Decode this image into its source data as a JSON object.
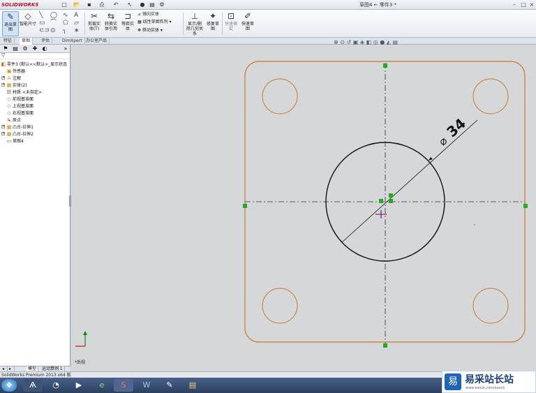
{
  "app": {
    "logo_text": "SOLIDWORKS",
    "document_title": "草图4 ← 零件3 *"
  },
  "ribbon": {
    "exit_sketch": "退出草图",
    "smart_dimension": "智能尺寸",
    "trim_entities": "剪裁实体(T)",
    "convert_entities": "转换实体引用",
    "offset_entities": "等距实体",
    "mirror_entities": "镜向实体",
    "linear_pattern": "线性草图阵列",
    "move_entities": "移动实体",
    "display_delete_relations": "显示/删除几何关系",
    "repair_sketch": "修复草图",
    "quick_snaps": "快速捕捉",
    "rapid_sketch": "快速草图"
  },
  "command_tabs": [
    "特征",
    "草图",
    "评估",
    "DimXpert",
    "办公室产品"
  ],
  "active_command_tab": 1,
  "feature_tree": [
    {
      "label": "零件3 (默认<<默认>_显示状态",
      "icon": "part-icon"
    },
    {
      "label": "传感器",
      "icon": "sensor-icon"
    },
    {
      "label": "注解",
      "icon": "annotation-icon"
    },
    {
      "label": "实体(2)",
      "icon": "solid-bodies-icon"
    },
    {
      "label": "材质 <未指定>",
      "icon": "material-icon"
    },
    {
      "label": "前视基准面",
      "icon": "plane-icon"
    },
    {
      "label": "上视基准面",
      "icon": "plane-icon"
    },
    {
      "label": "右视基准面",
      "icon": "plane-icon"
    },
    {
      "label": "原点",
      "icon": "origin-icon"
    },
    {
      "label": "凸台-拉伸1",
      "icon": "boss-extrude-icon"
    },
    {
      "label": "凸台-拉伸2",
      "icon": "boss-extrude-icon"
    },
    {
      "label": "草图4",
      "icon": "sketch-icon"
    }
  ],
  "bottom_tabs": [
    "模型",
    "运动算例 1"
  ],
  "view_label": "*后视",
  "status_bar": "SolidWorks Premium 2013 x64 版",
  "sketch": {
    "dimension_text": "34",
    "dimension_symbol": "⌀"
  },
  "colors": {
    "sketch_orange": "#c97a2a",
    "sketch_black": "#111111",
    "centerline": "#333333",
    "point_green": "#22aa22"
  },
  "watermark": {
    "logo": "易",
    "title": "易采站长站",
    "url": "www.easck.com/easck"
  }
}
